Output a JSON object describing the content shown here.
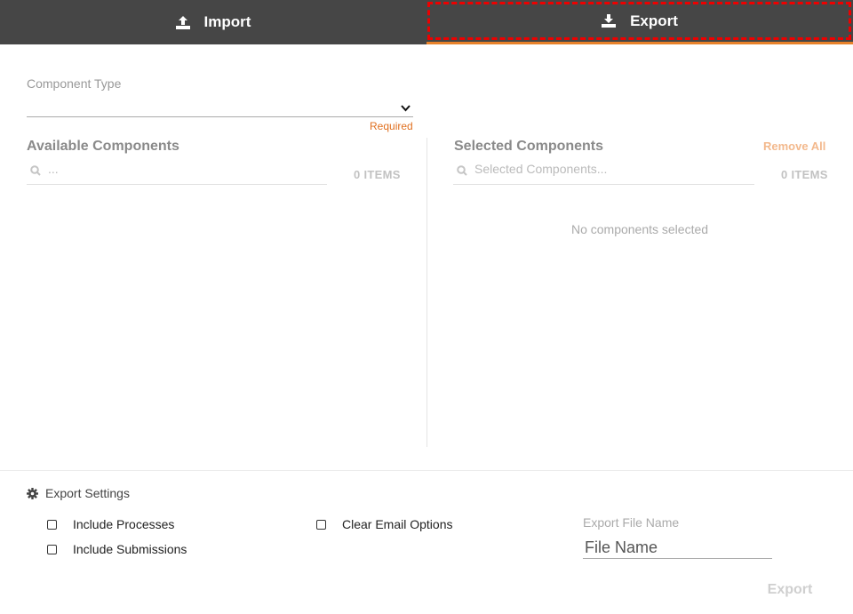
{
  "tabs": [
    {
      "label": "Import",
      "icon": "upload-icon"
    },
    {
      "label": "Export",
      "icon": "download-icon"
    }
  ],
  "component_type": {
    "label": "Component Type",
    "value": "",
    "required_text": "Required"
  },
  "available": {
    "title": "Available Components",
    "search_placeholder": "...",
    "count": "0 ITEMS"
  },
  "selected": {
    "title": "Selected Components",
    "search_placeholder": "Selected Components...",
    "count": "0 ITEMS",
    "remove_all": "Remove All",
    "empty_text": "No components selected"
  },
  "settings": {
    "title": "Export Settings",
    "options": [
      {
        "label": "Include Processes",
        "checked": false
      },
      {
        "label": "Include Submissions",
        "checked": false
      },
      {
        "label": "Clear Email Options",
        "checked": false
      }
    ],
    "file_name_label": "Export File Name",
    "file_name_placeholder": "File Name"
  },
  "export_button": "Export",
  "colors": {
    "tabbar": "#464646",
    "accent": "#e8822a",
    "required": "#e07020",
    "highlight": "#ee0000"
  }
}
